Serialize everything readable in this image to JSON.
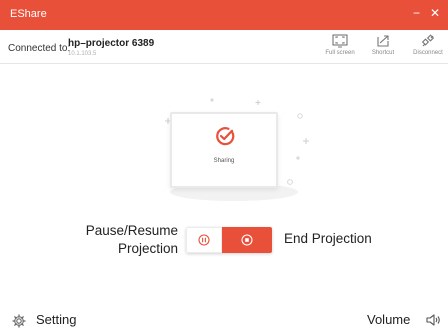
{
  "window": {
    "title": "EShare",
    "minimize_glyph": "−",
    "close_glyph": "✕"
  },
  "connection": {
    "label": "Connected to:",
    "device_name": "hp–projector 6389",
    "device_ip": "10.1.103.5"
  },
  "toolbar": {
    "fullscreen_label": "Full screen",
    "shortcut_label": "Shortcut",
    "disconnect_label": "Disconnect"
  },
  "status": {
    "sharing_text": "Sharing",
    "icon": "check-circle-icon"
  },
  "controls": {
    "pause_resume_label": "Pause/Resume Projection",
    "end_label": "End Projection"
  },
  "footer": {
    "setting_label": "Setting",
    "volume_label": "Volume"
  },
  "colors": {
    "accent": "#e8503a",
    "text": "#222222",
    "muted": "#888888"
  }
}
